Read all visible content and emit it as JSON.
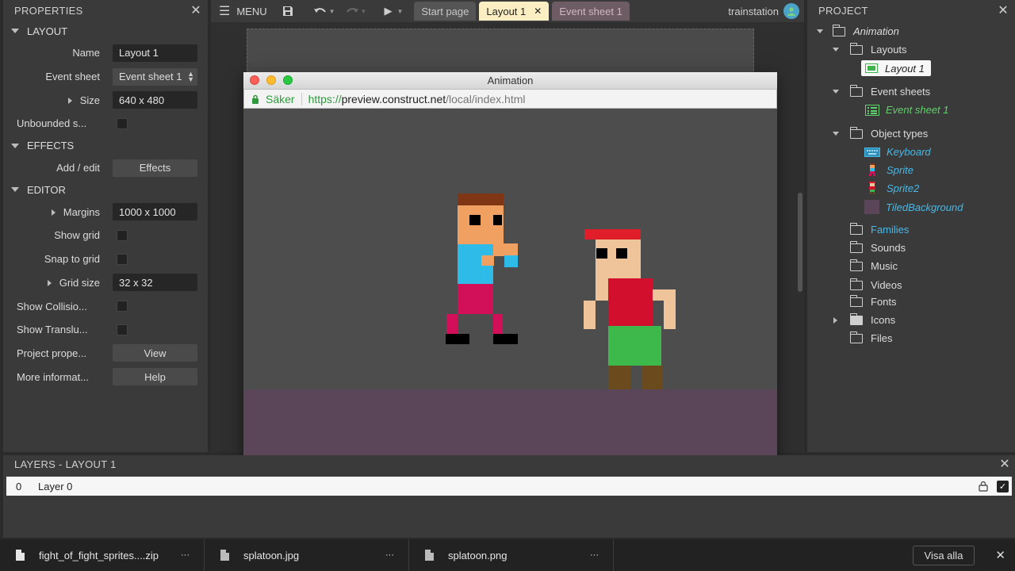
{
  "properties": {
    "title": "PROPERTIES",
    "sections": {
      "layout": "LAYOUT",
      "effects": "EFFECTS",
      "editor": "EDITOR"
    },
    "name_label": "Name",
    "name_value": "Layout 1",
    "event_sheet_label": "Event sheet",
    "event_sheet_value": "Event sheet 1",
    "size_label": "Size",
    "size_value": "640 x 480",
    "unbounded_label": "Unbounded s...",
    "add_edit_label": "Add / edit",
    "effects_button": "Effects",
    "margins_label": "Margins",
    "margins_value": "1000 x 1000",
    "show_grid_label": "Show grid",
    "snap_grid_label": "Snap to grid",
    "grid_size_label": "Grid size",
    "grid_size_value": "32 x 32",
    "show_collision_label": "Show Collisio...",
    "show_translucent_label": "Show Translu...",
    "project_props_label": "Project prope...",
    "view_button": "View",
    "more_info_label": "More informat...",
    "help_button": "Help"
  },
  "toolbar": {
    "menu_label": "MENU",
    "tabs": [
      {
        "label": "Start page"
      },
      {
        "label": "Layout 1"
      },
      {
        "label": "Event sheet 1"
      }
    ],
    "user": "trainstation"
  },
  "preview": {
    "window_title": "Animation",
    "secure_label": "Säker",
    "url_scheme": "https://",
    "url_host": "preview.construct.net",
    "url_path": "/local/index.html"
  },
  "project": {
    "title": "PROJECT",
    "root": "Animation",
    "layouts": "Layouts",
    "layout_1": "Layout 1",
    "event_sheets": "Event sheets",
    "event_sheet_1": "Event sheet 1",
    "object_types": "Object types",
    "objects": [
      {
        "label": "Keyboard",
        "icon": "keyboard-icon"
      },
      {
        "label": "Sprite",
        "icon": "sprite-icon"
      },
      {
        "label": "Sprite2",
        "icon": "sprite2-icon"
      },
      {
        "label": "TiledBackground",
        "icon": "tiled-background-icon"
      }
    ],
    "families": "Families",
    "sounds": "Sounds",
    "music": "Music",
    "videos": "Videos",
    "fonts": "Fonts",
    "icons": "Icons",
    "files": "Files"
  },
  "layers": {
    "title": "LAYERS - LAYOUT 1",
    "rows": [
      {
        "index": "0",
        "name": "Layer 0"
      }
    ]
  },
  "downloads": {
    "items": [
      {
        "name": "fight_of_fight_sprites....zip"
      },
      {
        "name": "splatoon.jpg"
      },
      {
        "name": "splatoon.png"
      }
    ],
    "show_all": "Visa alla",
    "more": "···"
  },
  "colors": {
    "panel_bg": "#3a3a3a",
    "active_tab": "#fbeec2",
    "event_tab": "#6e5c64",
    "link_blue": "#49b8e6",
    "event_green": "#5fd16a",
    "ground": "#5a4658",
    "game_bg": "#4e4d4e"
  }
}
